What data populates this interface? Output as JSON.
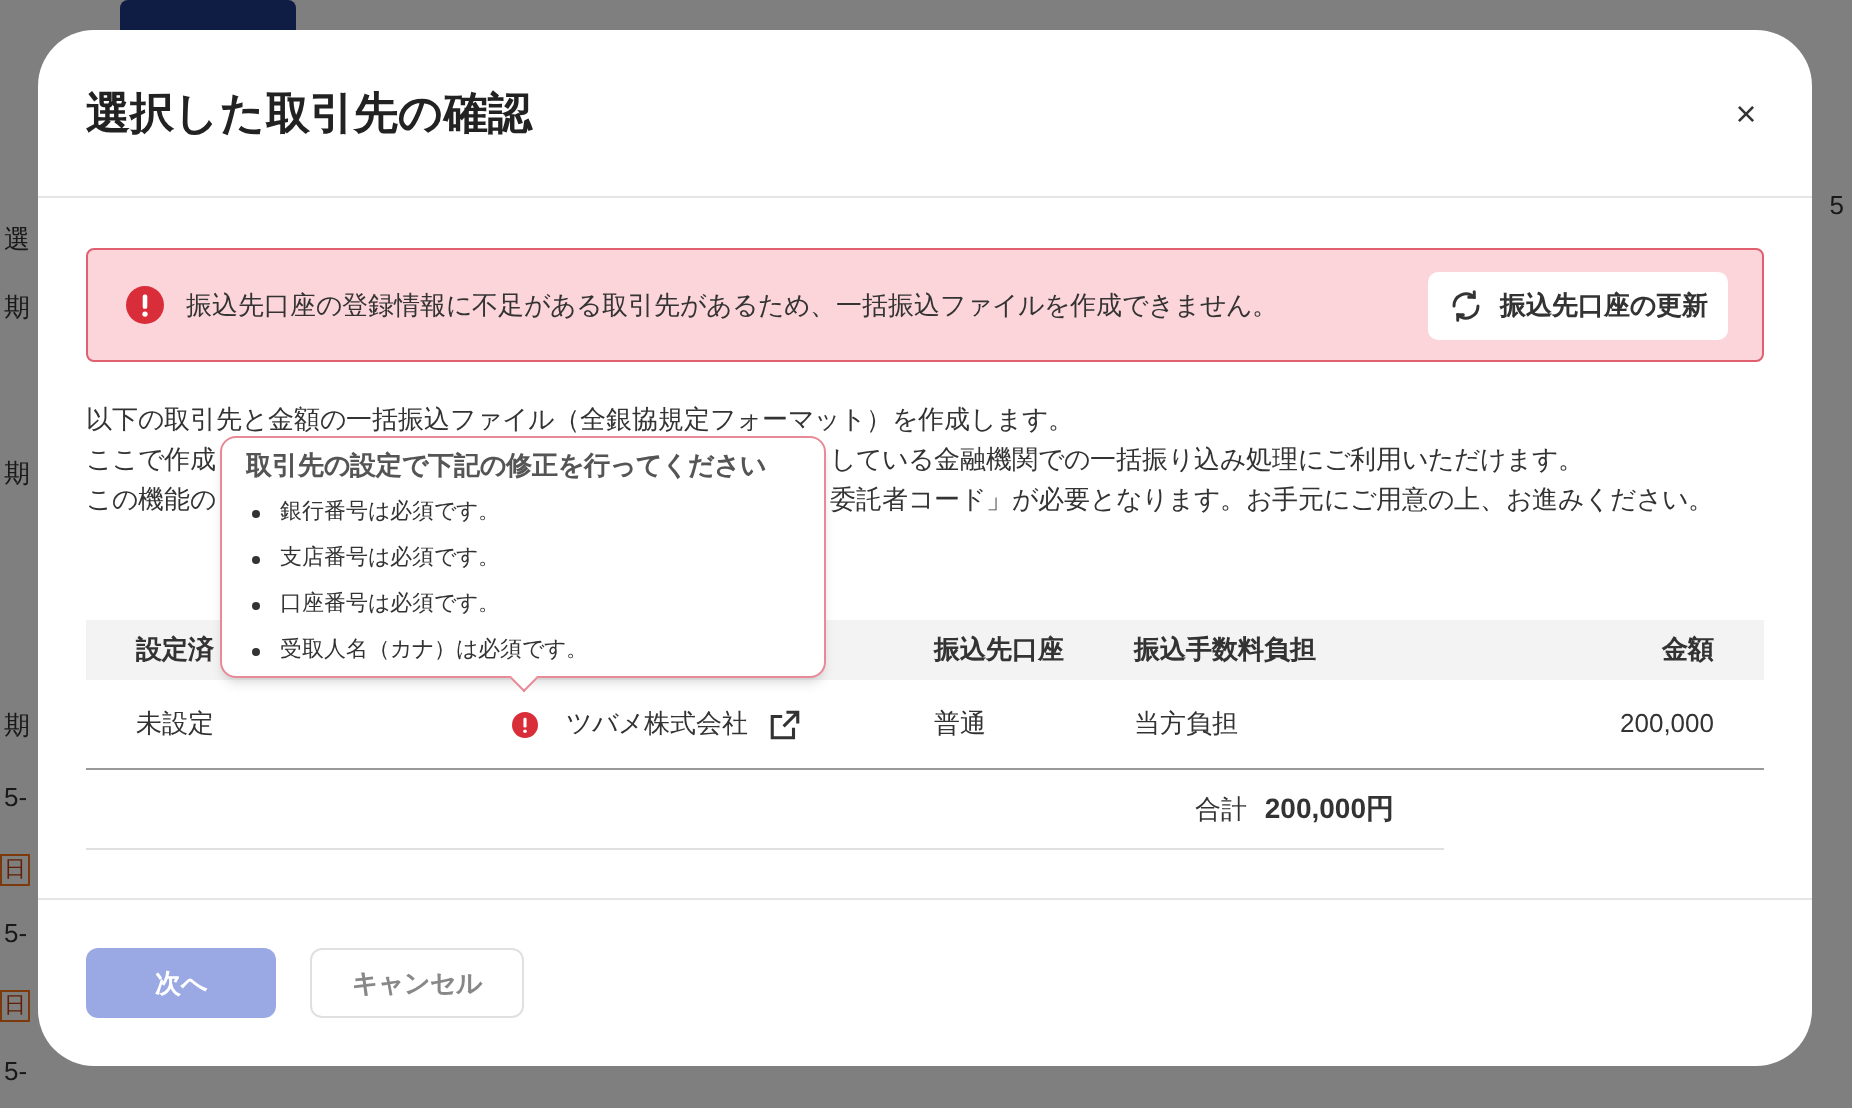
{
  "background": {
    "cells": [
      {
        "text": "選",
        "kind": "text"
      },
      {
        "text": "期",
        "kind": "text"
      },
      {
        "text": "期",
        "kind": "text"
      },
      {
        "text": "期",
        "kind": "text"
      },
      {
        "text": "5-",
        "kind": "text"
      },
      {
        "text": "日",
        "kind": "badge"
      },
      {
        "text": "5-",
        "kind": "text"
      },
      {
        "text": "日",
        "kind": "badge"
      },
      {
        "text": "5-",
        "kind": "text"
      }
    ],
    "count": "5"
  },
  "dialog": {
    "title": "選択した取引先の確認",
    "close": "×",
    "alert": {
      "message": "振込先口座の登録情報に不足がある取引先があるため、一括振込ファイルを作成できません。",
      "action": "振込先口座の更新"
    },
    "description": [
      {
        "left": "以下の取引先と金額の一括振込ファイル（全銀協規定フォーマット）を作成します。"
      },
      {
        "left": "ここで作成",
        "right": "している金融機関での一括振り込み処理にご利用いただけます。"
      },
      {
        "left": "この機能の",
        "right": "委託者コード」が必要となります。お手元にご用意の上、お進みください。"
      }
    ],
    "tooltip": {
      "title": "取引先の設定で下記の修正を行ってください",
      "items": [
        "銀行番号は必須です。",
        "支店番号は必須です。",
        "口座番号は必須です。",
        "受取人名（カナ）は必須です。"
      ]
    },
    "table": {
      "columns": [
        "設定済",
        "",
        "振込先口座",
        "振込手数料負担",
        "金額"
      ],
      "rows": [
        {
          "status": "未設定",
          "partner": "ツバメ株式会社",
          "error": true,
          "account": "普通",
          "fee": "当方負担",
          "amount": "200,000"
        }
      ],
      "total_label": "合計",
      "total": "200,000円"
    },
    "buttons": [
      {
        "label": "次へ",
        "kind": "primary",
        "disabled": true
      },
      {
        "label": "キャンセル",
        "kind": "secondary",
        "disabled": false
      }
    ]
  }
}
